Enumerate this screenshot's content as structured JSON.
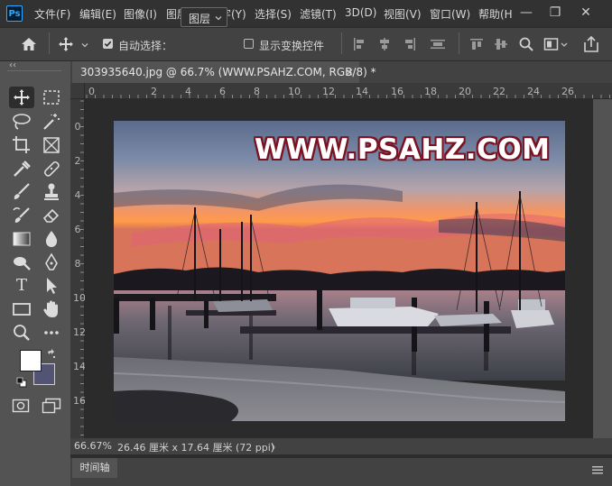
{
  "app": {
    "logo": "Ps"
  },
  "menu": {
    "items": [
      "文件(F)",
      "编辑(E)",
      "图像(I)",
      "图层(L)",
      "文字(Y)",
      "选择(S)",
      "滤镜(T)",
      "3D(D)",
      "视图(V)",
      "窗口(W)",
      "帮助(H"
    ]
  },
  "window_controls": {
    "minimize": "—",
    "maximize": "❐",
    "close": "✕"
  },
  "options": {
    "auto_select_label": "自动选择：",
    "auto_select_checked": true,
    "layer_value": "图层",
    "show_transform_label": "显示变换控件",
    "show_transform_checked": false
  },
  "document": {
    "tab_title": "303935640.jpg @ 66.7% (WWW.PSAHZ.COM, RGB/8) *",
    "tab_close": "×",
    "watermark_text": "WWW.PSAHZ.COM"
  },
  "ruler": {
    "h_ticks": [
      "0",
      "2",
      "4",
      "6",
      "8",
      "10",
      "12",
      "14",
      "16",
      "18",
      "20",
      "22",
      "24",
      "26"
    ],
    "v_ticks": [
      "0",
      "2",
      "4",
      "6",
      "8",
      "10",
      "12",
      "14",
      "16"
    ]
  },
  "status": {
    "zoom": "66.67%",
    "doc_size": "26.46 厘米 x 17.64 厘米 (72 ppi)",
    "arrow": "〉"
  },
  "timeline": {
    "tab_label": "时间轴"
  },
  "toolbar": {
    "collapse": "‹‹"
  }
}
